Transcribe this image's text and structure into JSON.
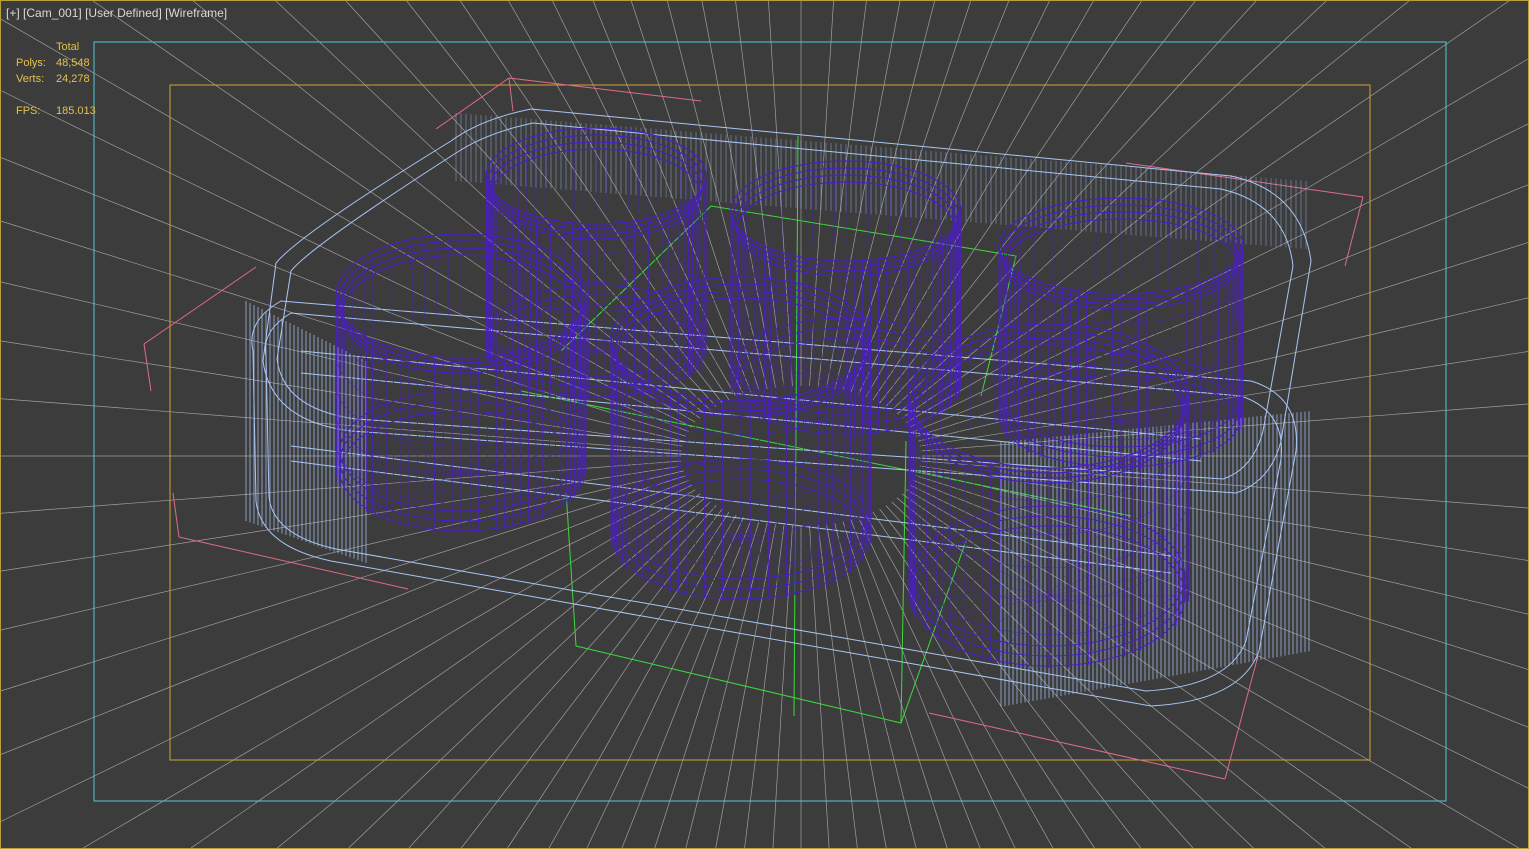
{
  "viewport": {
    "labels": {
      "plus_menu": "[+]",
      "camera": "[Cam_001]",
      "view_mode": "[User Defined]",
      "shading": "[Wireframe]"
    },
    "stats": {
      "header": "Total",
      "polys_label": "Polys:",
      "polys_value": "48,548",
      "verts_label": "Verts:",
      "verts_value": "24,278",
      "fps_label": "FPS:",
      "fps_value": "185.013"
    }
  },
  "colors": {
    "background": "#3c3c3c",
    "viewport_border": "#b7a33a",
    "safe_frame_outer": "#52c7d6",
    "safe_frame_inner": "#d1a532",
    "perspective_lines": "#bfbfbf",
    "tray_wireframe": "#a9c6f5",
    "cup_wireframe": "#4a1fc2",
    "bounding_box": "#e06a8a",
    "selection_box": "#3adc3a",
    "stats_text": "#e3c24a",
    "label_text": "#d9d9d9"
  },
  "icons": [
    "wireframe-cup-icon",
    "wireframe-tray-icon"
  ]
}
